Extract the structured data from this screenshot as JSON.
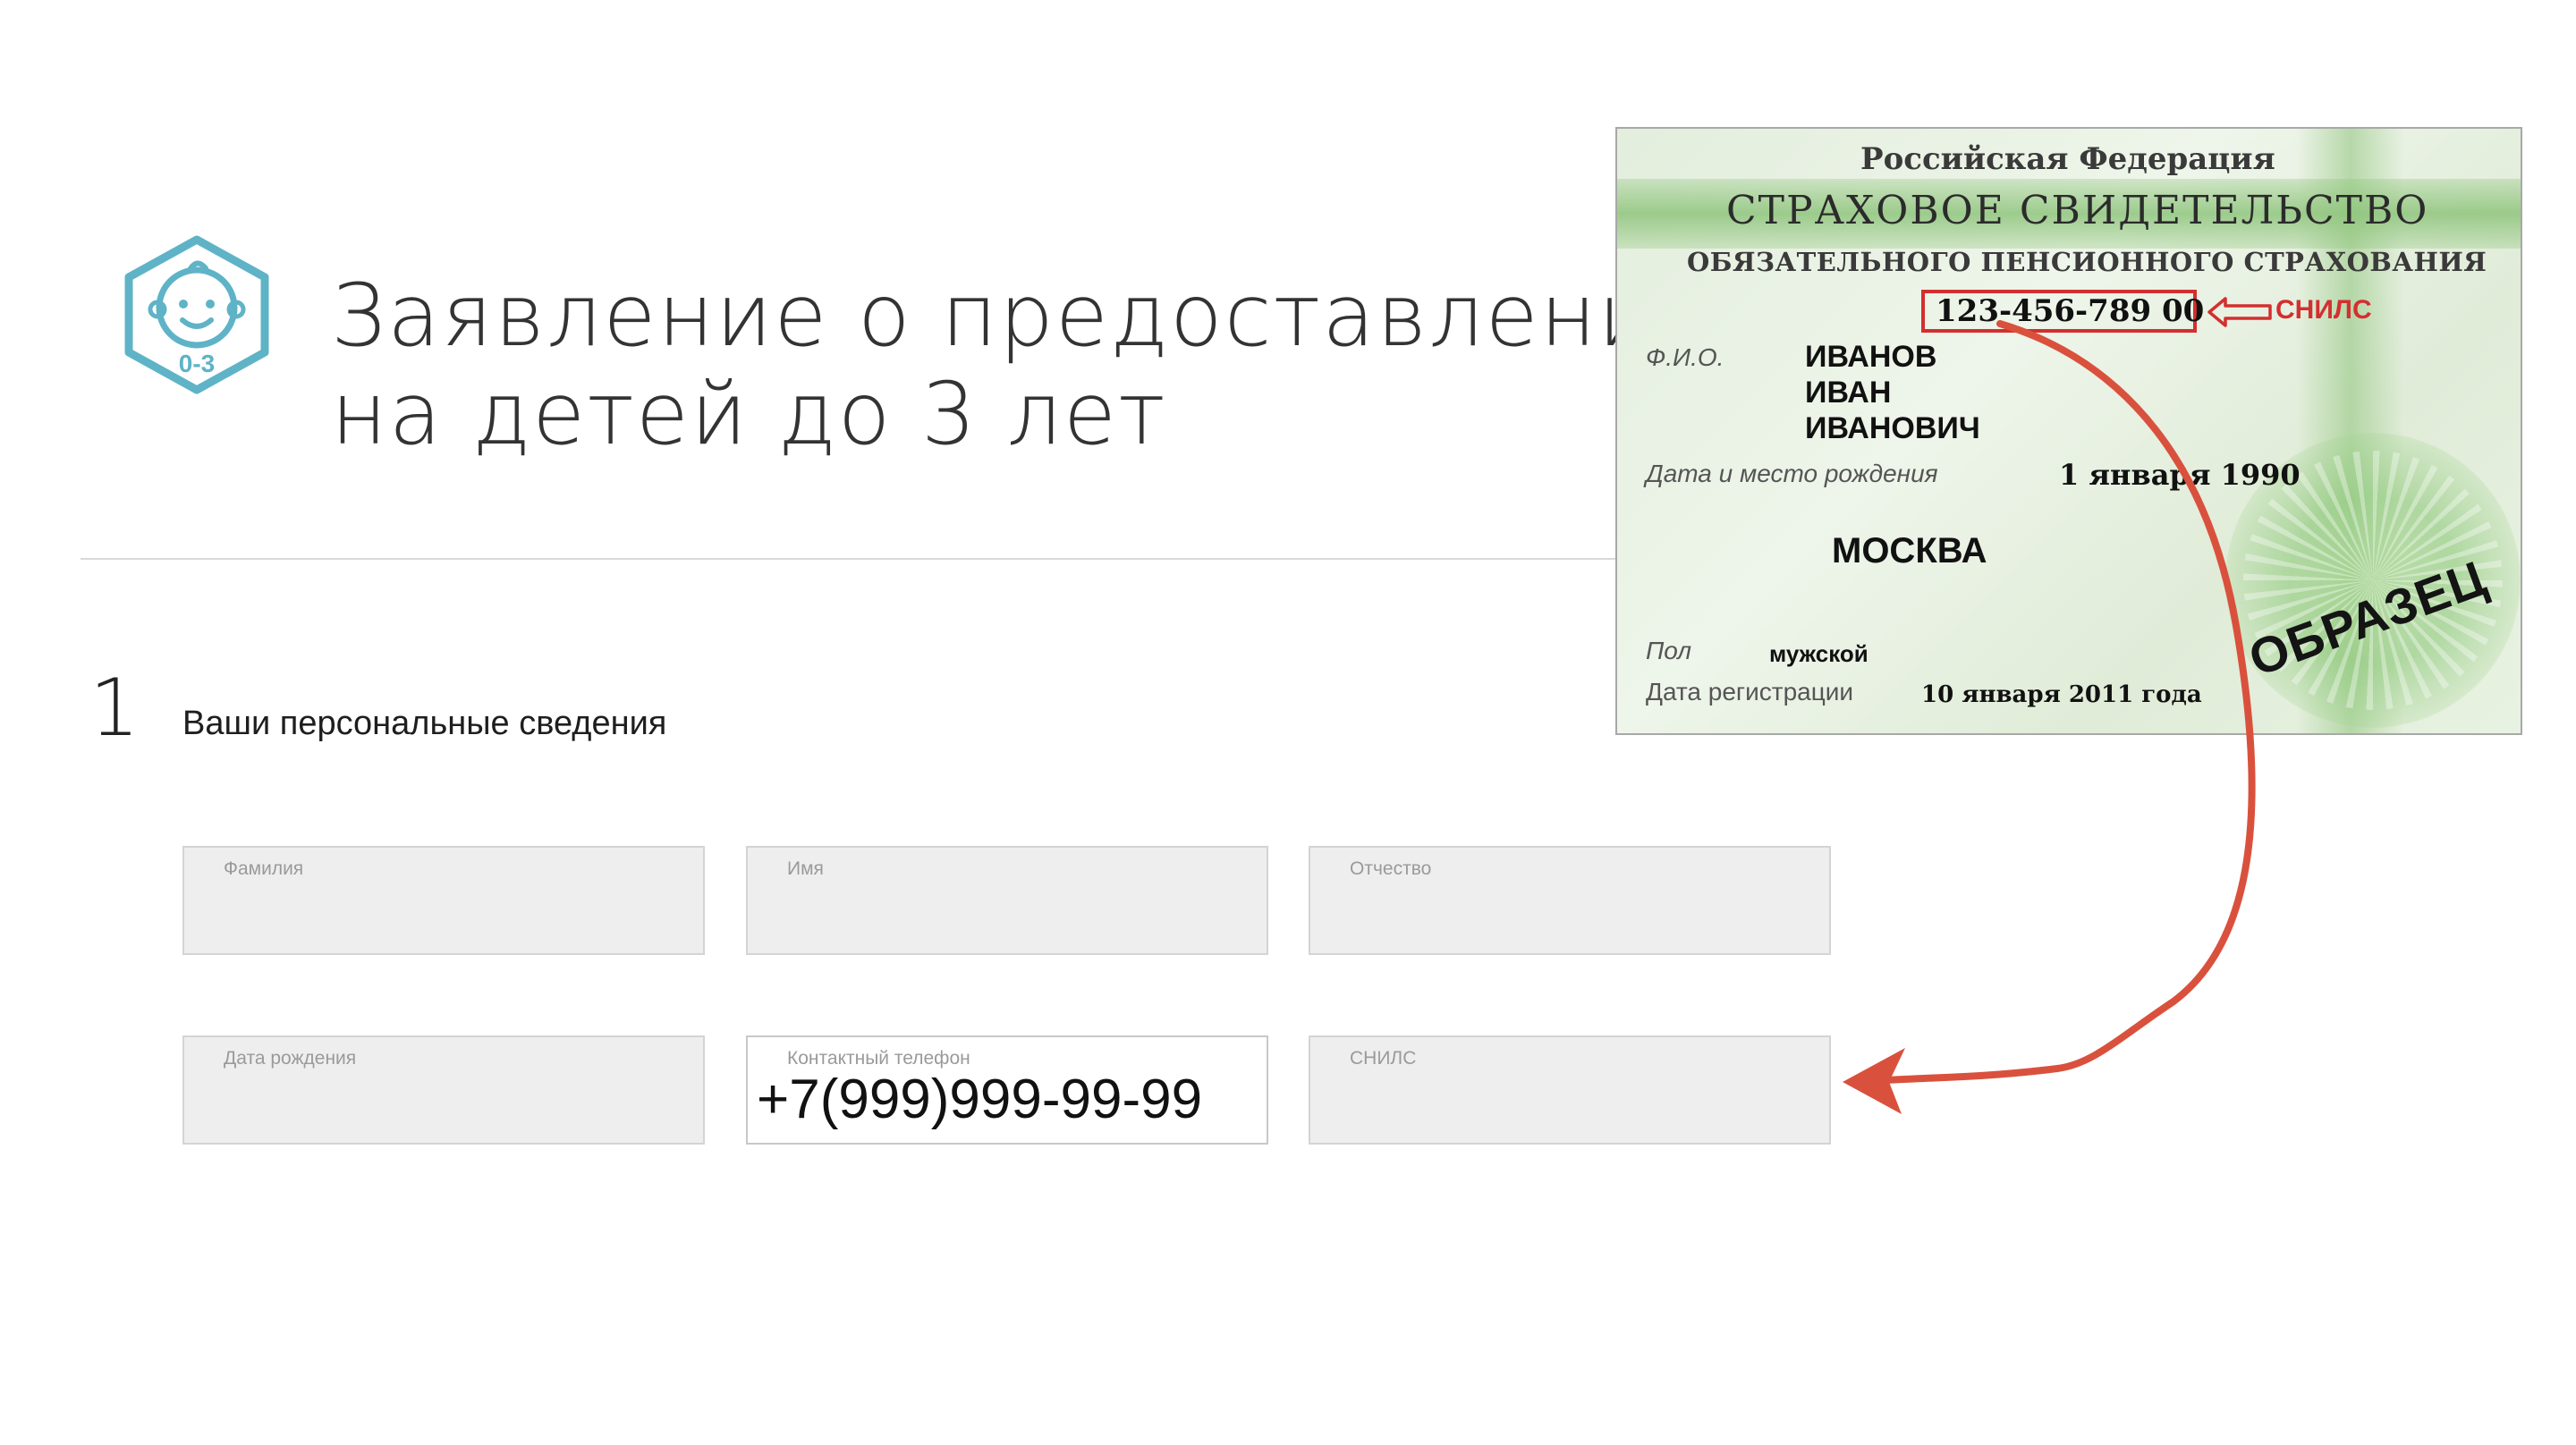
{
  "header": {
    "logo_icon": "baby-face-hexagon-icon",
    "logo_caption": "0-3",
    "title_line1": "Заявление о предоставлении еж",
    "title_line2": "на детей до 3 лет"
  },
  "section": {
    "number": "1",
    "title": "Ваши персональные сведения"
  },
  "form": {
    "fields": [
      {
        "label": "Фамилия",
        "value": ""
      },
      {
        "label": "Имя",
        "value": ""
      },
      {
        "label": "Отчество",
        "value": ""
      },
      {
        "label": "Дата рождения",
        "value": ""
      },
      {
        "label": "Контактный телефон",
        "value": "+7(999)999-99-99"
      },
      {
        "label": "СНИЛС",
        "value": ""
      }
    ]
  },
  "card": {
    "country": "Российская Федерация",
    "title": "СТРАХОВОЕ СВИДЕТЕЛЬСТВО",
    "subtitle": "ОБЯЗАТЕЛЬНОГО ПЕНСИОННОГО СТРАХОВАНИЯ",
    "number": "123-456-789 00",
    "number_callout": "СНИЛС",
    "fio_label": "Ф.И.О.",
    "last_name": "ИВАНОВ",
    "first_name": "ИВАН",
    "patronymic": "ИВАНОВИЧ",
    "birth_label": "Дата и место рождения",
    "birth_date": "1 января 1990",
    "birth_place": "МОСКВА",
    "sex_label": "Пол",
    "sex": "мужской",
    "reg_label": "Дата регистрации",
    "reg_date": "10 января 2011 года",
    "stamp": "ОБРАЗЕЦ"
  },
  "colors": {
    "accent_teal": "#5fb3c7",
    "annotation_red": "#d32f2f",
    "field_bg": "#eeeeee",
    "card_green": "#8fc77a"
  }
}
